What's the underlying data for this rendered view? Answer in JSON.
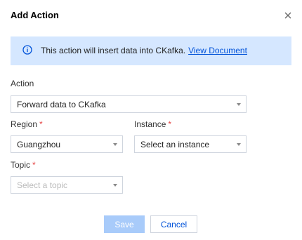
{
  "dialog": {
    "title": "Add Action"
  },
  "info": {
    "message": "This action will insert data into CKafka.",
    "link": "View Document"
  },
  "form": {
    "action": {
      "label": "Action",
      "value": "Forward data to CKafka"
    },
    "region": {
      "label": "Region",
      "required_mark": "*",
      "value": "Guangzhou"
    },
    "instance": {
      "label": "Instance",
      "required_mark": "*",
      "value": "Select an instance"
    },
    "topic": {
      "label": "Topic",
      "required_mark": "*",
      "placeholder": "Select a topic"
    }
  },
  "buttons": {
    "save": "Save",
    "cancel": "Cancel"
  },
  "colors": {
    "info_bg": "#d5e7ff",
    "link": "#0052d9",
    "required": "#e54545",
    "save_disabled": "#a8cbfa"
  },
  "icons": {
    "close": "close-icon",
    "info": "info-icon",
    "caret": "chevron-down-icon"
  }
}
